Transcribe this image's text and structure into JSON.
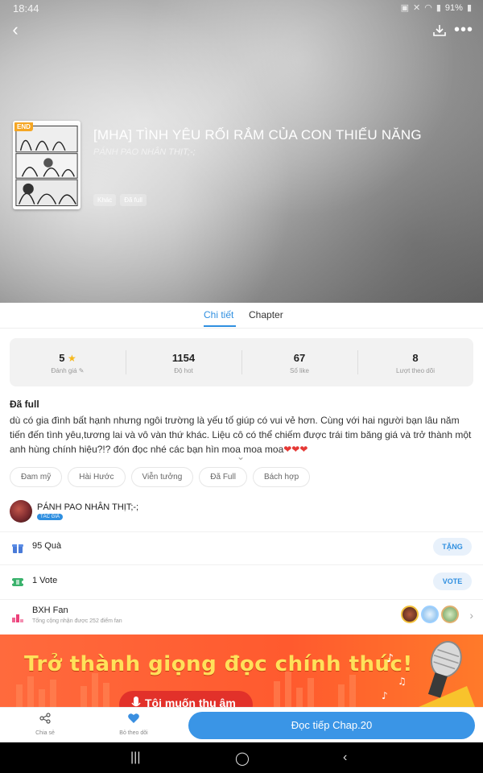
{
  "status_bar": {
    "time": "18:44",
    "battery": "91%"
  },
  "header": {
    "title": "[MHA] TÌNH YÊU RỐI RẮM CỦA CON THIẾU NĂNG",
    "author": "PÁNH PAO NHÂN THỊT;-;",
    "cover_badge": "END",
    "tags": [
      "Khác",
      "Đã full"
    ]
  },
  "tabs": [
    {
      "label": "Chi tiết",
      "active": true
    },
    {
      "label": "Chapter",
      "active": false
    }
  ],
  "stats": [
    {
      "value": "5",
      "label": "Đánh giá",
      "icon": "star-icon"
    },
    {
      "value": "1154",
      "label": "Độ hot"
    },
    {
      "value": "67",
      "label": "Số like"
    },
    {
      "value": "8",
      "label": "Lượt theo dõi"
    }
  ],
  "description": {
    "status": "Đã full",
    "text": "dù có gia đình bất hạnh nhưng ngôi trường là yếu tố giúp có vui vẻ hơn. Cùng với hai người bạn lâu năm tiến đến tình yêu,tương lai và vô vàn thứ khác. Liệu cô có thể chiếm được trái tim băng giá và trở thành một anh hùng chính hiệu?!? đón đọc nhé các bạn hìn moa moa moa",
    "hearts": "❤❤❤"
  },
  "genres": [
    "Đam mỹ",
    "Hài Hước",
    "Viễn tưởng",
    "Đã Full",
    "Bách hợp"
  ],
  "author_row": {
    "name": "PÁNH PAO NHÂN THỊT;-;",
    "badge": "TÁC GIẢ"
  },
  "gifts": {
    "label": "95 Quà",
    "button": "TẶNG"
  },
  "votes": {
    "label": "1 Vote",
    "button": "VOTE"
  },
  "fans": {
    "label": "BXH Fan",
    "sub": "Tổng cộng nhận được 252 điểm fan"
  },
  "banner": {
    "headline": "Trở thành giọng đọc chính thức!",
    "button": "Tôi muốn thu âm"
  },
  "bottom_bar": {
    "share": "Chia sẻ",
    "unfollow": "Bỏ theo dõi",
    "read": "Đọc tiếp Chap.20"
  },
  "colors": {
    "accent": "#2f8fe0",
    "read_button": "#3a95e6",
    "banner": "#ff5a2e",
    "banner_text": "#ffe15a"
  }
}
